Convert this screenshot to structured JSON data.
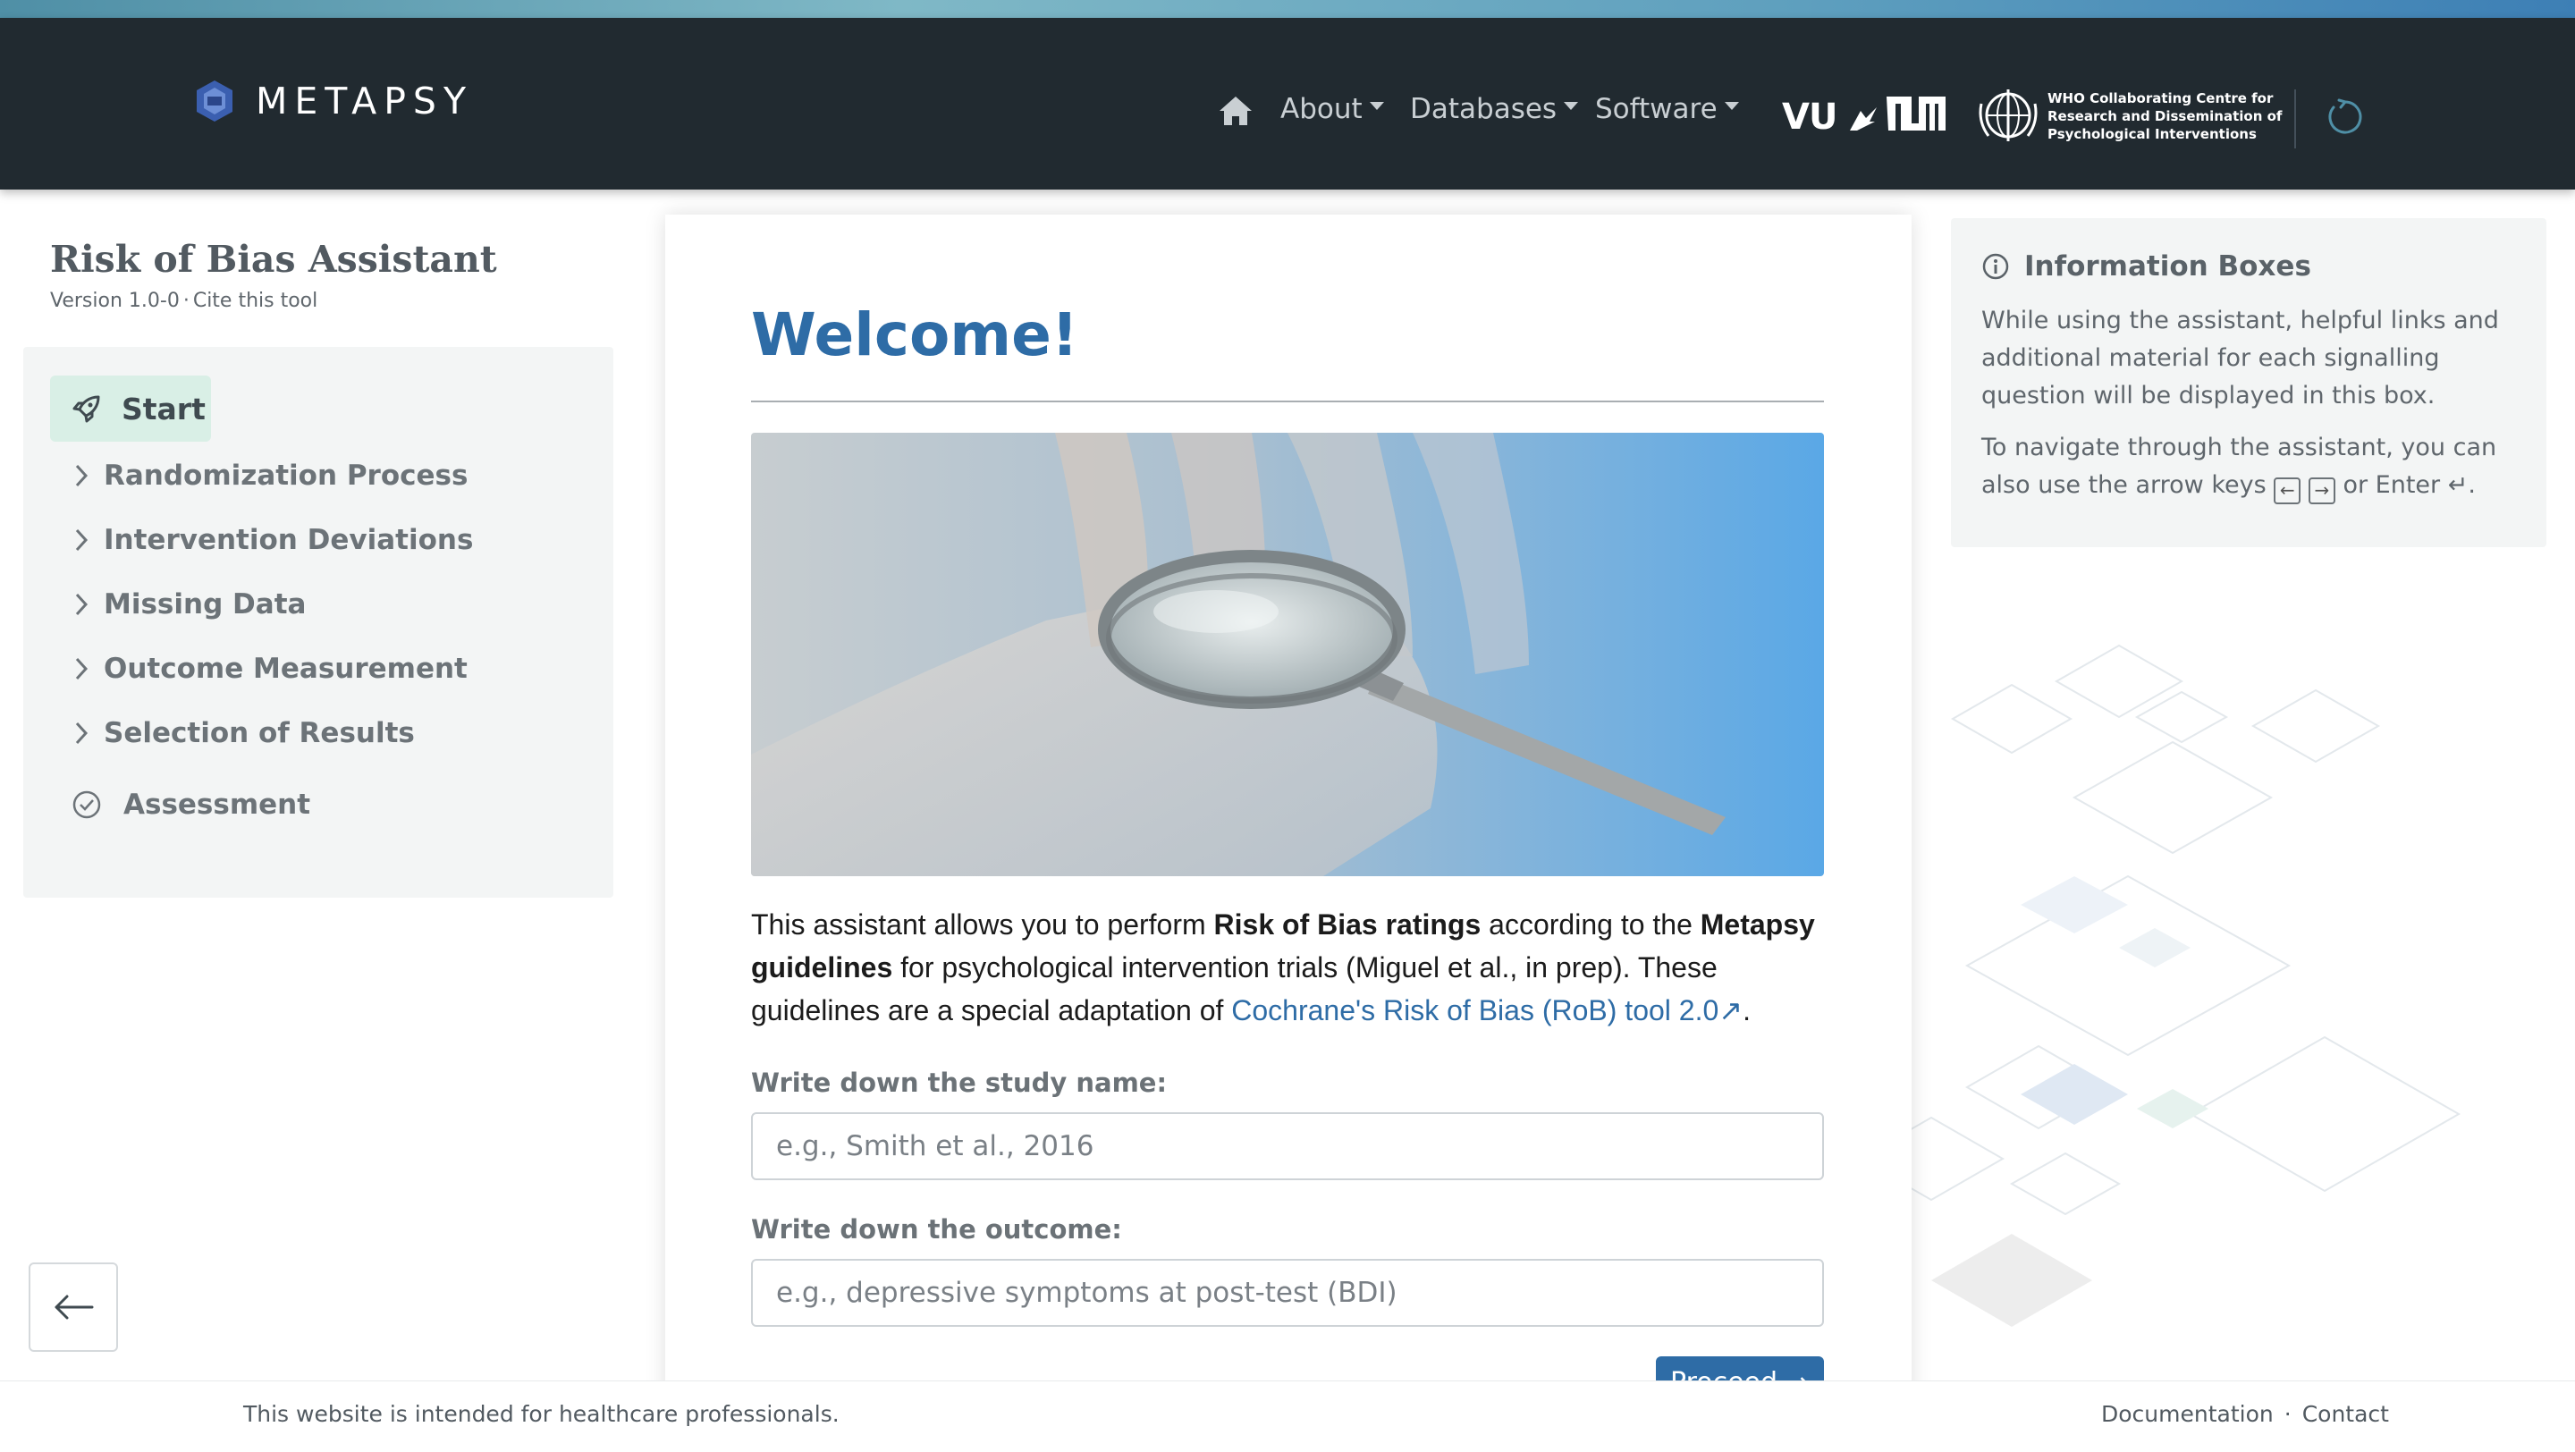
{
  "navbar": {
    "brand": "METAPSY",
    "items": [
      {
        "label": "About"
      },
      {
        "label": "Databases"
      },
      {
        "label": "Software"
      }
    ],
    "partners": {
      "vu": "VU",
      "who_text": "WHO Collaborating Centre for Research and Dissemination of Psychological Interventions"
    },
    "colors": {
      "background": "#212a30",
      "text": "#c9cfd3"
    }
  },
  "sidebar": {
    "title": "Risk of Bias Assistant",
    "version": "Version 1.0-0",
    "cite": "Cite this tool",
    "start_label": "Start",
    "items": [
      {
        "label": "Randomization Process"
      },
      {
        "label": "Intervention Deviations"
      },
      {
        "label": "Missing Data"
      },
      {
        "label": "Outcome Measurement"
      },
      {
        "label": "Selection of Results"
      }
    ],
    "assessment_label": "Assessment",
    "colors": {
      "start_bg": "#d9efe6",
      "panel_bg": "#f3f5f5"
    }
  },
  "main": {
    "heading": "Welcome!",
    "intro": {
      "p1": "This assistant allows you to perform ",
      "b1": "Risk of Bias ratings",
      "p2": " according to the ",
      "b2": "Metapsy guidelines",
      "p3": " for psychological intervention trials (Miguel et al., in prep). These guidelines are a special adaptation of ",
      "link": "Cochrane's Risk of Bias (RoB) tool 2.0↗",
      "p4": "."
    },
    "study_label": "Write down the study name:",
    "study_placeholder": "e.g., Smith et al., 2016",
    "outcome_label": "Write down the outcome:",
    "outcome_placeholder": "e.g., depressive symptoms at post-test (BDI)",
    "proceed_label": "Proceed →",
    "colors": {
      "accent": "#2e6ca6"
    }
  },
  "info_box": {
    "title": "Information Boxes",
    "text1": "While using the assistant, helpful links and additional material for each signalling question will be displayed in this box.",
    "text2_a": "To navigate through the assistant, you can also use the arrow keys ",
    "key_left": "←",
    "key_right": "→",
    "text2_b": " or Enter ",
    "enter_symbol": "↵",
    "text2_c": "."
  },
  "footer": {
    "note": "This website is intended for healthcare professionals.",
    "links": [
      {
        "label": "Documentation"
      },
      {
        "label": "Contact"
      }
    ],
    "separator": "·"
  }
}
